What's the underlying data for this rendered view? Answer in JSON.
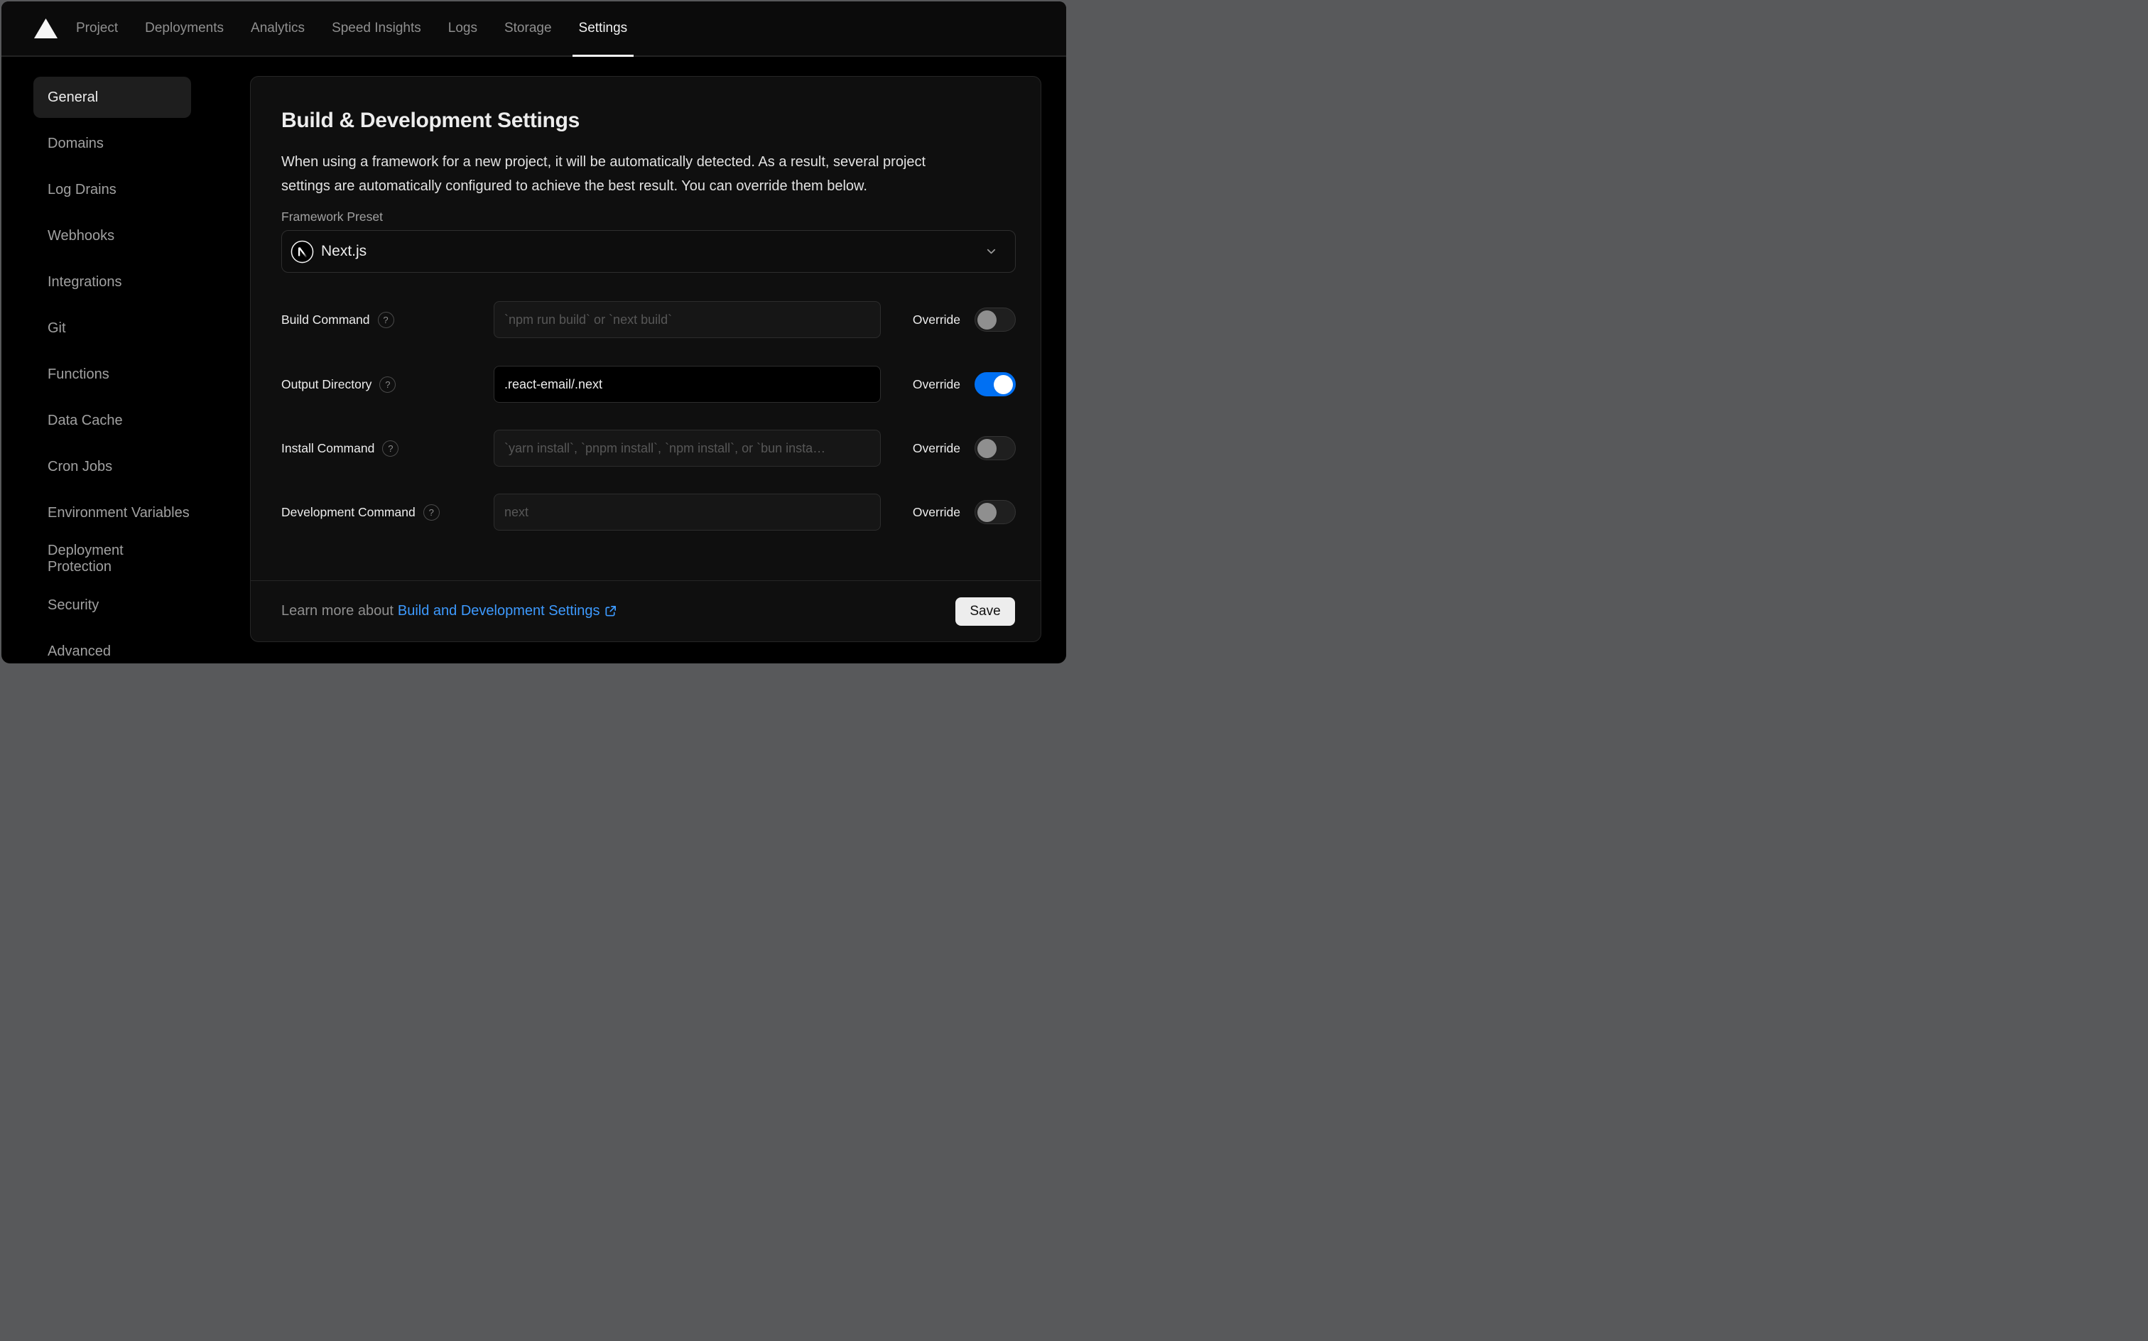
{
  "nav": {
    "items": [
      {
        "label": "Project",
        "active": false
      },
      {
        "label": "Deployments",
        "active": false
      },
      {
        "label": "Analytics",
        "active": false
      },
      {
        "label": "Speed Insights",
        "active": false
      },
      {
        "label": "Logs",
        "active": false
      },
      {
        "label": "Storage",
        "active": false
      },
      {
        "label": "Settings",
        "active": true
      }
    ]
  },
  "sidebar": {
    "active": "General",
    "items": [
      {
        "label": "General"
      },
      {
        "label": "Domains"
      },
      {
        "label": "Log Drains"
      },
      {
        "label": "Webhooks"
      },
      {
        "label": "Integrations"
      },
      {
        "label": "Git"
      },
      {
        "label": "Functions"
      },
      {
        "label": "Data Cache"
      },
      {
        "label": "Cron Jobs"
      },
      {
        "label": "Environment Variables"
      },
      {
        "label": "Deployment Protection"
      },
      {
        "label": "Security"
      },
      {
        "label": "Advanced"
      }
    ]
  },
  "panel": {
    "title": "Build & Development Settings",
    "description": "When using a framework for a new project, it will be automatically detected. As a result, several project\nsettings are automatically configured to achieve the best result. You can override them below.",
    "framework": {
      "label": "Framework Preset",
      "value": "Next.js",
      "icon": "nextjs-logo-icon"
    },
    "rows": [
      {
        "label": "Build Command",
        "placeholder": "`npm run build` or `next build`",
        "value": "",
        "override_label": "Override",
        "override_on": false
      },
      {
        "label": "Output Directory",
        "placeholder": "",
        "value": ".react-email/.next",
        "override_label": "Override",
        "override_on": true
      },
      {
        "label": "Install Command",
        "placeholder": "`yarn install`, `pnpm install`, `npm install`, or `bun insta…",
        "value": "",
        "override_label": "Override",
        "override_on": false
      },
      {
        "label": "Development Command",
        "placeholder": "next",
        "value": "",
        "override_label": "Override",
        "override_on": false
      }
    ],
    "footer": {
      "prefix": "Learn more about",
      "link_text": "Build and Development Settings",
      "save_label": "Save"
    }
  },
  "colors": {
    "toggle_on_blue": "#0070f3",
    "link_blue": "#3d9aff",
    "card_background": "#0f0f0f",
    "page_background": "#000000"
  }
}
